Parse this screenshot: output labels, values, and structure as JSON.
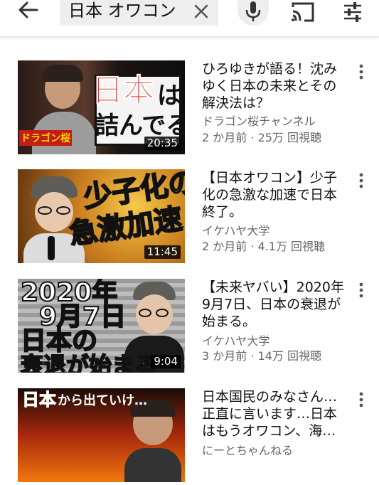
{
  "search": {
    "query": "日本 オワコン"
  },
  "icons": {
    "back": "arrow-left-icon",
    "clear": "close-icon",
    "mic": "microphone-icon",
    "cast": "cast-icon",
    "filter": "filter-sliders-icon",
    "more": "more-vertical-icon"
  },
  "videos": [
    {
      "title": "ひろゆきが語る！沈みゆく日本の未来とその解決法は？",
      "channel": "ドラゴン桜チャンネル",
      "meta": "2 か月前 · 25万 回視聴",
      "duration": "20:35",
      "thumb_text": [
        "日本",
        "は",
        "詰んでる"
      ],
      "thumb_logo": "ドラゴン桜"
    },
    {
      "title": "【日本オワコン】少子化の急激な加速で日本終了。",
      "channel": "イケハヤ大学",
      "meta": "2 か月前 · 4.1万 回視聴",
      "duration": "11:45",
      "thumb_text": [
        "少子化の",
        "急激加速"
      ]
    },
    {
      "title": "【未来ヤバい】2020年9月7日、日本の衰退が始まる。",
      "channel": "イケハヤ大学",
      "meta": "3 か月前 · 14万 回視聴",
      "duration": "9:04",
      "thumb_text": [
        "2020年",
        "9月7日",
        "日本の",
        "衰退が始まる"
      ]
    },
    {
      "title": "日本国民のみなさん…正直に言います…日本はもうオワコン、海…",
      "channel": "にーとちゃんねる",
      "meta": "",
      "duration": "",
      "thumb_text": [
        "日本",
        "から出ていけ…"
      ]
    }
  ],
  "colors": {
    "accent_red": "#e0201c",
    "text": "#111111",
    "secondary": "#666666"
  }
}
